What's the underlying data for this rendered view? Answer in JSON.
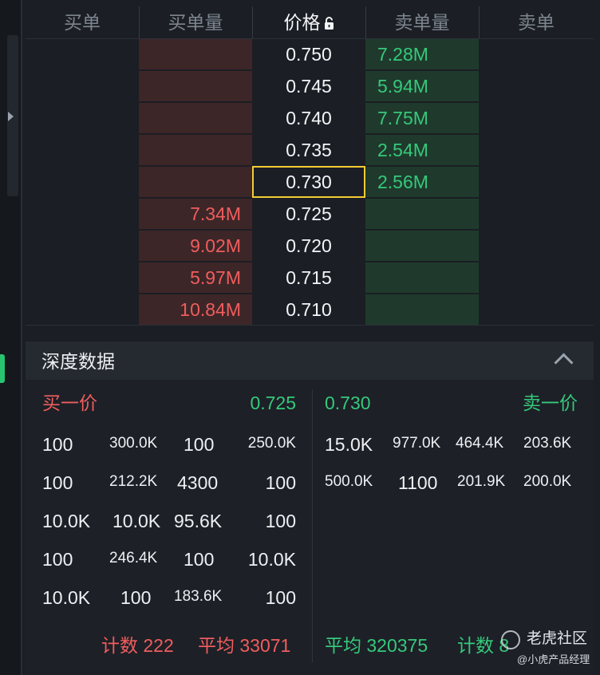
{
  "order_book": {
    "headers": {
      "buy_orders": "买单",
      "buy_volume": "买单量",
      "price": "价格",
      "sell_volume": "卖单量",
      "sell_orders": "卖单"
    },
    "rows": [
      {
        "price": "0.750",
        "bid_volume": "",
        "ask_volume": "7.28M"
      },
      {
        "price": "0.745",
        "bid_volume": "",
        "ask_volume": "5.94M"
      },
      {
        "price": "0.740",
        "bid_volume": "",
        "ask_volume": "7.75M"
      },
      {
        "price": "0.735",
        "bid_volume": "",
        "ask_volume": "2.54M"
      },
      {
        "price": "0.730",
        "bid_volume": "",
        "ask_volume": "2.56M"
      },
      {
        "price": "0.725",
        "bid_volume": "7.34M",
        "ask_volume": ""
      },
      {
        "price": "0.720",
        "bid_volume": "9.02M",
        "ask_volume": ""
      },
      {
        "price": "0.715",
        "bid_volume": "5.97M",
        "ask_volume": ""
      },
      {
        "price": "0.710",
        "bid_volume": "10.84M",
        "ask_volume": ""
      }
    ],
    "selected_price": "0.730"
  },
  "depth": {
    "title": "深度数据",
    "bid": {
      "label": "买一价",
      "price": "0.725",
      "orders": [
        [
          "100",
          "300.0K",
          "100",
          "250.0K"
        ],
        [
          "100",
          "212.2K",
          "4300",
          "100"
        ],
        [
          "10.0K",
          "10.0K",
          "95.6K",
          "100"
        ],
        [
          "100",
          "246.4K",
          "100",
          "10.0K"
        ],
        [
          "10.0K",
          "100",
          "183.6K",
          "100"
        ]
      ],
      "count_label": "计数 222",
      "avg_label": "平均 33071"
    },
    "ask": {
      "label": "卖一价",
      "price": "0.730",
      "orders": [
        [
          "15.0K",
          "977.0K",
          "464.4K",
          "203.6K"
        ],
        [
          "500.0K",
          "1100",
          "201.9K",
          "200.0K"
        ]
      ],
      "avg_label": "平均 320375",
      "count_label": "计数 8"
    }
  },
  "watermark": {
    "main": "老虎社区",
    "sub": "@小虎产品经理"
  },
  "colors": {
    "bid_red": "#f05d5d",
    "ask_green": "#35c97b",
    "selected_border": "#f4cc35"
  },
  "icons": {
    "lock": "unlock-icon",
    "collapse": "chevron-up-icon",
    "expand": "caret-right-icon"
  }
}
